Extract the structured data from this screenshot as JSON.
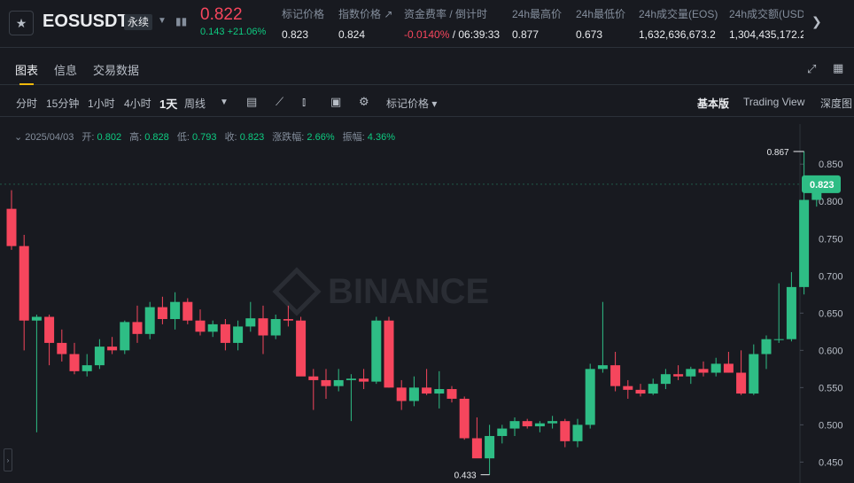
{
  "header": {
    "symbol": "EOSUSDT",
    "badge": "永续",
    "price": "0.822",
    "change": "0.143 +21.06%",
    "stats": [
      {
        "label": "标记价格",
        "value": "0.823"
      },
      {
        "label": "指数价格 ↗",
        "value": "0.824"
      },
      {
        "label": "资金费率 / 倒计时",
        "value_red": "-0.0140%",
        "value": " / 06:39:33"
      },
      {
        "label": "24h最高价",
        "value": "0.877"
      },
      {
        "label": "24h最低价",
        "value": "0.673"
      },
      {
        "label": "24h成交量(EOS)",
        "value": "1,632,636,673.2"
      },
      {
        "label": "24h成交额(USD",
        "value": "1,304,435,172.2"
      }
    ]
  },
  "tabs": [
    "图表",
    "信息",
    "交易数据"
  ],
  "toolbar": {
    "intervals": [
      "分时",
      "15分钟",
      "1小时",
      "4小时",
      "1天",
      "周线"
    ],
    "active_interval": "1天",
    "price_type": "标记价格",
    "views": [
      "基本版",
      "Trading View",
      "深度图"
    ],
    "active_view": "基本版"
  },
  "ohlc": {
    "date": "2025/04/03",
    "open_label": "开:",
    "open": "0.802",
    "high_label": "高:",
    "high": "0.828",
    "low_label": "低:",
    "low": "0.793",
    "close_label": "收:",
    "close": "0.823",
    "chg_label": "涨跌幅:",
    "chg": "2.66%",
    "amp_label": "振幅:",
    "amp": "4.36%"
  },
  "watermark": "BINANCE",
  "chart_data": {
    "type": "candlestick",
    "ylim": [
      0.41,
      0.88
    ],
    "y_ticks": [
      "0.850",
      "0.800",
      "0.750",
      "0.700",
      "0.650",
      "0.600",
      "0.550",
      "0.500",
      "0.450"
    ],
    "last_price": "0.823",
    "max_label": "0.867",
    "min_label": "0.433",
    "candles": [
      [
        0.79,
        0.815,
        0.735,
        0.74
      ],
      [
        0.74,
        0.755,
        0.6,
        0.64
      ],
      [
        0.64,
        0.648,
        0.49,
        0.645
      ],
      [
        0.645,
        0.648,
        0.58,
        0.61
      ],
      [
        0.61,
        0.628,
        0.585,
        0.595
      ],
      [
        0.595,
        0.61,
        0.568,
        0.572
      ],
      [
        0.572,
        0.595,
        0.565,
        0.58
      ],
      [
        0.58,
        0.615,
        0.575,
        0.605
      ],
      [
        0.605,
        0.618,
        0.595,
        0.6
      ],
      [
        0.6,
        0.64,
        0.595,
        0.638
      ],
      [
        0.638,
        0.66,
        0.61,
        0.622
      ],
      [
        0.622,
        0.665,
        0.615,
        0.658
      ],
      [
        0.658,
        0.672,
        0.635,
        0.642
      ],
      [
        0.642,
        0.678,
        0.628,
        0.665
      ],
      [
        0.665,
        0.67,
        0.635,
        0.64
      ],
      [
        0.64,
        0.655,
        0.62,
        0.625
      ],
      [
        0.625,
        0.64,
        0.618,
        0.635
      ],
      [
        0.635,
        0.642,
        0.6,
        0.61
      ],
      [
        0.61,
        0.64,
        0.6,
        0.632
      ],
      [
        0.632,
        0.665,
        0.625,
        0.643
      ],
      [
        0.643,
        0.66,
        0.595,
        0.62
      ],
      [
        0.62,
        0.648,
        0.615,
        0.642
      ],
      [
        0.642,
        0.66,
        0.632,
        0.64
      ],
      [
        0.64,
        0.645,
        0.57,
        0.565
      ],
      [
        0.565,
        0.575,
        0.52,
        0.56
      ],
      [
        0.56,
        0.575,
        0.535,
        0.552
      ],
      [
        0.552,
        0.575,
        0.545,
        0.56
      ],
      [
        0.56,
        0.568,
        0.505,
        0.562
      ],
      [
        0.562,
        0.575,
        0.548,
        0.558
      ],
      [
        0.558,
        0.645,
        0.555,
        0.64
      ],
      [
        0.64,
        0.645,
        0.55,
        0.55
      ],
      [
        0.55,
        0.56,
        0.52,
        0.532
      ],
      [
        0.532,
        0.565,
        0.525,
        0.55
      ],
      [
        0.55,
        0.575,
        0.54,
        0.542
      ],
      [
        0.542,
        0.572,
        0.522,
        0.548
      ],
      [
        0.548,
        0.552,
        0.53,
        0.535
      ],
      [
        0.535,
        0.538,
        0.48,
        0.482
      ],
      [
        0.482,
        0.51,
        0.47,
        0.455
      ],
      [
        0.455,
        0.5,
        0.433,
        0.485
      ],
      [
        0.485,
        0.5,
        0.475,
        0.495
      ],
      [
        0.495,
        0.51,
        0.485,
        0.505
      ],
      [
        0.505,
        0.508,
        0.495,
        0.498
      ],
      [
        0.498,
        0.505,
        0.49,
        0.502
      ],
      [
        0.502,
        0.512,
        0.495,
        0.505
      ],
      [
        0.505,
        0.508,
        0.47,
        0.478
      ],
      [
        0.478,
        0.508,
        0.47,
        0.5
      ],
      [
        0.5,
        0.582,
        0.495,
        0.575
      ],
      [
        0.575,
        0.665,
        0.57,
        0.58
      ],
      [
        0.58,
        0.598,
        0.545,
        0.552
      ],
      [
        0.552,
        0.56,
        0.535,
        0.547
      ],
      [
        0.547,
        0.555,
        0.538,
        0.542
      ],
      [
        0.542,
        0.562,
        0.54,
        0.555
      ],
      [
        0.555,
        0.575,
        0.548,
        0.568
      ],
      [
        0.568,
        0.58,
        0.56,
        0.565
      ],
      [
        0.565,
        0.578,
        0.555,
        0.575
      ],
      [
        0.575,
        0.585,
        0.565,
        0.57
      ],
      [
        0.57,
        0.59,
        0.565,
        0.582
      ],
      [
        0.582,
        0.598,
        0.57,
        0.57
      ],
      [
        0.57,
        0.6,
        0.54,
        0.542
      ],
      [
        0.542,
        0.608,
        0.54,
        0.595
      ],
      [
        0.595,
        0.62,
        0.575,
        0.615
      ],
      [
        0.615,
        0.69,
        0.61,
        0.615
      ],
      [
        0.615,
        0.705,
        0.612,
        0.685
      ],
      [
        0.685,
        0.867,
        0.675,
        0.802
      ],
      [
        0.802,
        0.828,
        0.793,
        0.823
      ]
    ]
  }
}
